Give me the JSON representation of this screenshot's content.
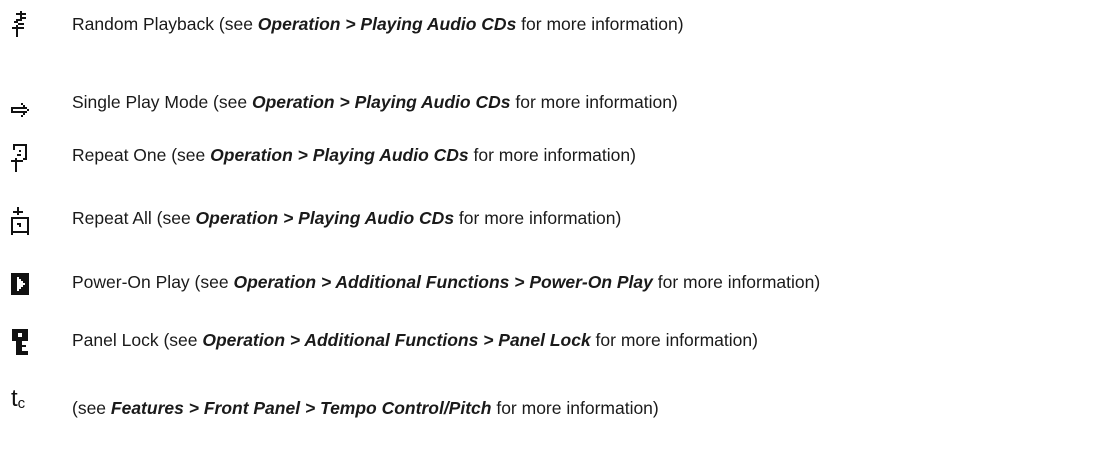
{
  "rows": [
    {
      "icon": "random-playback-icon",
      "label": "Random Playback (see ",
      "bold1": "Operation",
      "sep1": " > ",
      "bold2": "Playing Audio CDs",
      "tail": " for more information)"
    },
    {
      "icon": "single-play-mode-icon",
      "label": "Single Play Mode (see ",
      "bold1": "Operation",
      "sep1": " > ",
      "bold2": "Playing Audio CDs",
      "tail": " for more information)"
    },
    {
      "icon": "repeat-one-icon",
      "label": "Repeat One (see ",
      "bold1": "Operation",
      "sep1": " > ",
      "bold2": "Playing Audio CDs",
      "tail": " for more information)"
    },
    {
      "icon": "repeat-all-icon",
      "label": "Repeat All (see ",
      "bold1": "Operation",
      "sep1": " > ",
      "bold2": "Playing Audio CDs",
      "tail": " for more information)"
    },
    {
      "icon": "power-on-play-icon",
      "label": "Power-On Play (see ",
      "bold1": "Operation",
      "sep1": " > ",
      "bold2": "Additional Functions",
      "sep2": " > ",
      "bold3": "Power-On Play",
      "tail": " for more information)"
    },
    {
      "icon": "panel-lock-icon",
      "label": "Panel Lock (see ",
      "bold1": "Operation",
      "sep1": " > ",
      "bold2": "Additional Functions",
      "sep2": " > ",
      "bold3": "Panel Lock",
      "tail": " for more information)"
    },
    {
      "icon": "tempo-control-icon",
      "icon_text": "t",
      "icon_sub": "c",
      "label": "(see ",
      "bold1": "Features",
      "sep1": " > ",
      "bold2": "Front Panel",
      "sep2": " > ",
      "bold3": "Tempo Control/Pitch",
      "tail": " for more information)"
    }
  ]
}
